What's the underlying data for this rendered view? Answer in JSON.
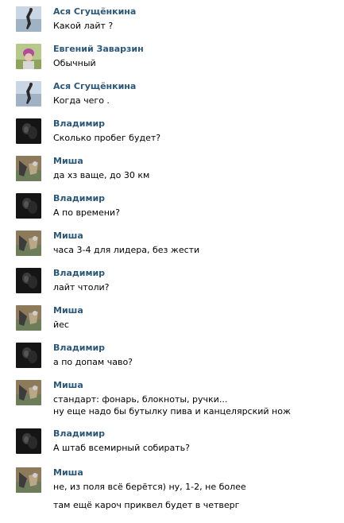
{
  "messages": [
    {
      "author": "Ася Сгущёнкина",
      "avatar": "asya-avatar",
      "lines": [
        "Какой лайт ?"
      ]
    },
    {
      "author": "Евгений Заварзин",
      "avatar": "evgeniy-avatar",
      "lines": [
        "Обычный"
      ]
    },
    {
      "author": "Ася Сгущёнкина",
      "avatar": "asya-avatar",
      "lines": [
        "Когда чего ."
      ]
    },
    {
      "author": "Владимир",
      "avatar": "vladimir-avatar",
      "lines": [
        "Сколько пробег будет?"
      ]
    },
    {
      "author": "Миша",
      "avatar": "misha-avatar",
      "lines": [
        "да хз ваще, до 30 км"
      ]
    },
    {
      "author": "Владимир",
      "avatar": "vladimir-avatar",
      "lines": [
        "А по времени?"
      ]
    },
    {
      "author": "Миша",
      "avatar": "misha-avatar",
      "lines": [
        "часа 3-4 для лидера, без жести"
      ]
    },
    {
      "author": "Владимир",
      "avatar": "vladimir-avatar",
      "lines": [
        "лайт чтоли?"
      ]
    },
    {
      "author": "Миша",
      "avatar": "misha-avatar",
      "lines": [
        "йес"
      ]
    },
    {
      "author": "Владимир",
      "avatar": "vladimir-avatar",
      "lines": [
        "а по допам чаво?"
      ]
    },
    {
      "author": "Миша",
      "avatar": "misha-avatar",
      "lines": [
        "стандарт: фонарь, блокноты, ручки...",
        "ну еще надо бы бутылку пива и канцелярский нож"
      ]
    },
    {
      "author": "Владимир",
      "avatar": "vladimir-avatar",
      "lines": [
        "А штаб всемирный собирать?"
      ]
    },
    {
      "author": "Миша",
      "avatar": "misha-avatar",
      "lines": [
        "не, из поля всё берётся) ну, 1-2, не более",
        "там ещё кароч приквел будет в четверг"
      ]
    }
  ],
  "colors": {
    "author_name": "#2b587a",
    "message_text": "#000000",
    "background": "#ffffff"
  }
}
